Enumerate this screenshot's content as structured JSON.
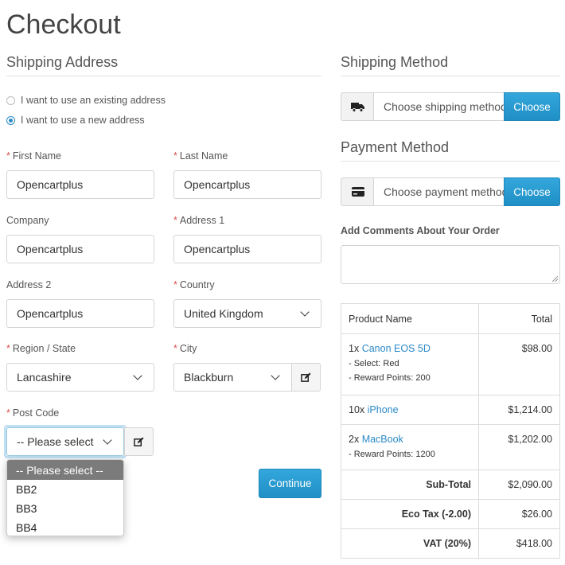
{
  "page": {
    "title": "Checkout"
  },
  "shipping_address": {
    "heading": "Shipping Address",
    "radio_existing": "I want to use an existing address",
    "radio_new": "I want to use a new address",
    "first_name": {
      "label": "First Name",
      "value": "Opencartplus"
    },
    "last_name": {
      "label": "Last Name",
      "value": "Opencartplus"
    },
    "company": {
      "label": "Company",
      "value": "Opencartplus"
    },
    "address1": {
      "label": "Address 1",
      "value": "Opencartplus"
    },
    "address2": {
      "label": "Address 2",
      "value": "Opencartplus"
    },
    "country": {
      "label": "Country",
      "value": "United Kingdom"
    },
    "region": {
      "label": "Region / State",
      "value": "Lancashire"
    },
    "city": {
      "label": "City",
      "value": "Blackburn"
    },
    "postcode": {
      "label": "Post Code",
      "value": "-- Please select --",
      "options": [
        "-- Please select --",
        "BB2",
        "BB3",
        "BB4"
      ]
    },
    "continue_label": "Continue"
  },
  "shipping_method": {
    "heading": "Shipping Method",
    "placeholder": "Choose shipping method",
    "button": "Choose"
  },
  "payment_method": {
    "heading": "Payment Method",
    "placeholder": "Choose payment method",
    "button": "Choose"
  },
  "comments": {
    "label": "Add Comments About Your Order"
  },
  "order": {
    "head_product": "Product Name",
    "head_total": "Total",
    "items": [
      {
        "qty": "1x",
        "name": "Canon EOS 5D",
        "options": [
          "- Select: Red",
          "- Reward Points: 200"
        ],
        "total": "$98.00"
      },
      {
        "qty": "10x",
        "name": "iPhone",
        "options": [],
        "total": "$1,214.00"
      },
      {
        "qty": "2x",
        "name": "MacBook",
        "options": [
          "- Reward Points: 1200"
        ],
        "total": "$1,202.00"
      }
    ],
    "totals": [
      {
        "label": "Sub-Total",
        "value": "$2,090.00"
      },
      {
        "label": "Eco Tax (-2.00)",
        "value": "$26.00"
      },
      {
        "label": "VAT (20%)",
        "value": "$418.00"
      }
    ]
  },
  "colors": {
    "accent": "#2a9fd6",
    "required": "#d9534f",
    "link": "#2a8ac8"
  }
}
